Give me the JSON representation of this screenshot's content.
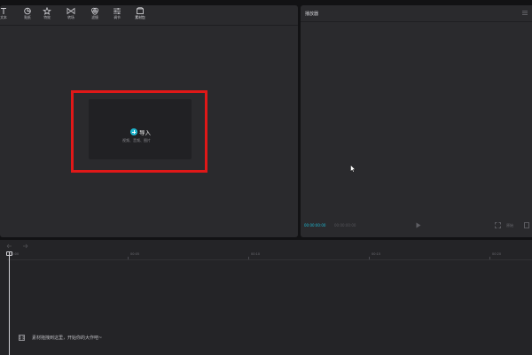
{
  "toolbar": {
    "items": [
      {
        "label": "文本",
        "icon": "text-icon"
      },
      {
        "label": "贴纸",
        "icon": "sticker-icon"
      },
      {
        "label": "特效",
        "icon": "effects-icon"
      },
      {
        "label": "转场",
        "icon": "transition-icon"
      },
      {
        "label": "滤镜",
        "icon": "filter-icon"
      },
      {
        "label": "调节",
        "icon": "adjust-icon"
      },
      {
        "label": "素材包",
        "icon": "material-pack-icon"
      }
    ]
  },
  "media": {
    "import_label": "导入",
    "import_hint": "视频、音频、图片",
    "accent": "#1fb5ce",
    "highlight_color": "#e01818"
  },
  "player": {
    "title": "播放器",
    "timecode": "00:00:00:00",
    "duration": "00:00:00:00",
    "ratio_label": "原始"
  },
  "timeline": {
    "ticks": [
      "00:00",
      "00:05",
      "00:10",
      "00:15",
      "00:20"
    ],
    "hint": "素材拖拽到这里，开始你的大作吧~"
  }
}
